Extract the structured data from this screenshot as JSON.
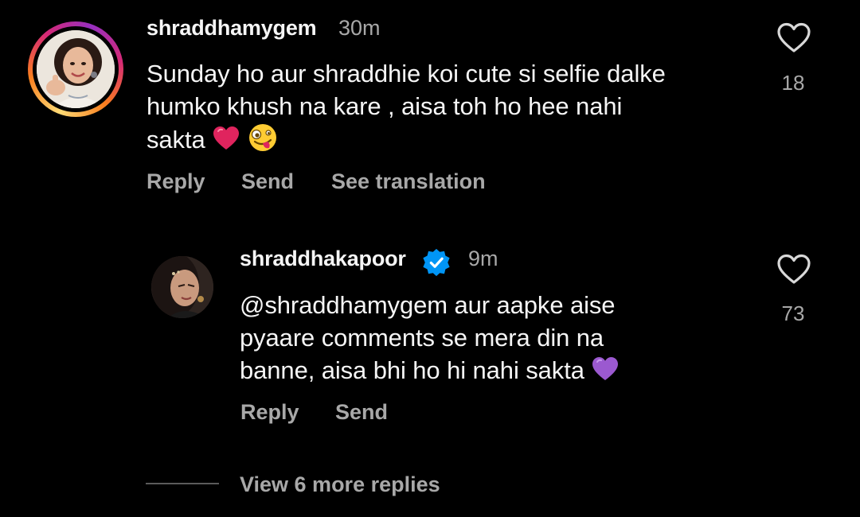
{
  "comment": {
    "username": "shraddhamygem",
    "time": "30m",
    "text": "Sunday ho aur shraddhie koi cute si selfie dalke humko khush na kare , aisa toh ho hee nahi sakta",
    "line1": "Sunday ho aur shraddhie koi cute si selfie dalke",
    "line2": "humko khush na kare , aisa toh ho hee nahi",
    "line3": "sakta",
    "emojis": [
      "red-heart-icon",
      "zany-face-icon"
    ],
    "likes": "18",
    "actions": {
      "reply": "Reply",
      "send": "Send",
      "see_translation": "See translation"
    }
  },
  "reply": {
    "username": "shraddhakapoor",
    "verified": true,
    "time": "9m",
    "mention": "@shraddhamygem",
    "line1_rest": " aur aapke aise",
    "line2": "pyaare comments se mera din na",
    "line3": "banne, aisa bhi ho hi nahi sakta",
    "emojis": [
      "purple-heart-icon"
    ],
    "likes": "73",
    "actions": {
      "reply": "Reply",
      "send": "Send"
    }
  },
  "view_more": "View 6 more replies",
  "colors": {
    "background": "#000000",
    "primary_text": "#f5f5f5",
    "secondary_text": "#a8a8a8",
    "verified_badge": "#0095f6",
    "heart_red": "#e0245e",
    "heart_purple": "#9b59d0"
  }
}
